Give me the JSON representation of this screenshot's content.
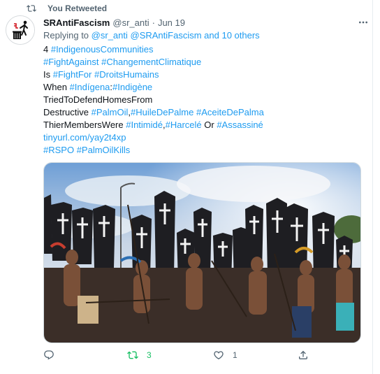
{
  "colors": {
    "accent": "#1d9bf0",
    "retweet_green": "#17bf63",
    "muted": "#536471",
    "text": "#0f1419"
  },
  "social_context": {
    "icon": "retweet-icon",
    "text": "You Retweeted"
  },
  "tweet": {
    "display_name": "SRAntiFascism",
    "handle": "@sr_anti",
    "separator": "·",
    "time": "Jun 19",
    "more_icon": "more-icon",
    "reply": {
      "prefix": "Replying to",
      "mentions": "@sr_anti @SRAntiFascism and 10 others"
    },
    "lines": [
      [
        {
          "t": "4 "
        },
        {
          "t": "#IndigenousCommunities",
          "tag": true
        }
      ],
      [
        {
          "t": "#FightAgainst",
          "tag": true
        },
        {
          "t": " "
        },
        {
          "t": "#ChangementClimatique",
          "tag": true
        }
      ],
      [
        {
          "t": "Is "
        },
        {
          "t": "#FightFor",
          "tag": true
        },
        {
          "t": " "
        },
        {
          "t": "#DroitsHumains",
          "tag": true
        }
      ],
      [
        {
          "t": "When "
        },
        {
          "t": "#Indígena",
          "tag": true
        },
        {
          "t": ":"
        },
        {
          "t": "#Indigène",
          "tag": true
        }
      ],
      [
        {
          "t": "TriedToDefendHomesFrom"
        }
      ],
      [
        {
          "t": "Destructive "
        },
        {
          "t": "#PalmOil",
          "tag": true
        },
        {
          "t": ","
        },
        {
          "t": "#HuileDePalme",
          "tag": true
        },
        {
          "t": " "
        },
        {
          "t": "#AceiteDePalma",
          "tag": true
        }
      ],
      [
        {
          "t": "ThierMembersWere "
        },
        {
          "t": "#Intimidé",
          "tag": true
        },
        {
          "t": ","
        },
        {
          "t": "#Harcelé",
          "tag": true
        },
        {
          "t": " Or "
        },
        {
          "t": "#Assassiné",
          "tag": true
        }
      ],
      [
        {
          "t": "tinyurl.com/yay2t4xp",
          "tag": true
        }
      ],
      [
        {
          "t": "#RSPO",
          "tag": true
        },
        {
          "t": " "
        },
        {
          "t": "#PalmOilKills",
          "tag": true
        }
      ]
    ],
    "media": {
      "description_icon": "protest-photo"
    },
    "actions": {
      "reply": {
        "icon": "reply-icon",
        "count": ""
      },
      "retweet": {
        "icon": "retweet-icon",
        "count": "3"
      },
      "like": {
        "icon": "heart-icon",
        "count": "1"
      },
      "share": {
        "icon": "share-icon",
        "count": ""
      }
    }
  }
}
